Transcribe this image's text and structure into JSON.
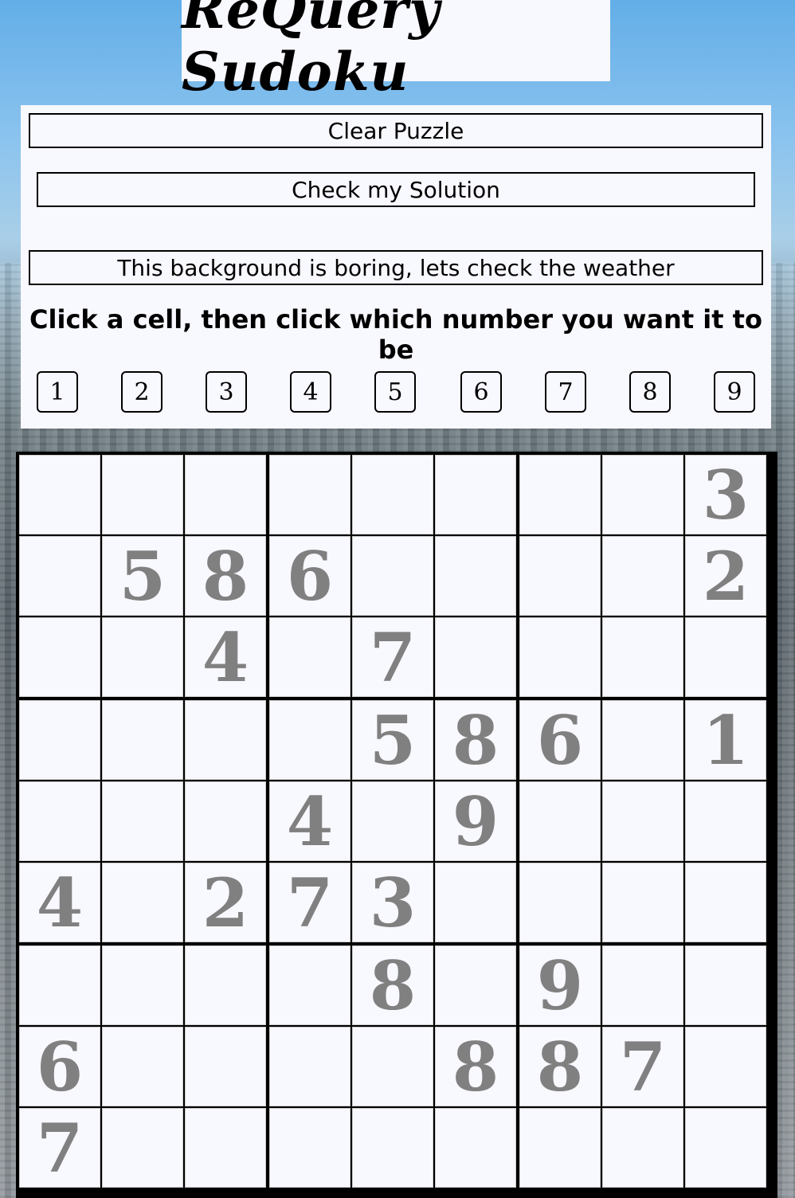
{
  "title": "ReQuery Sudoku",
  "buttons": {
    "clear": "Clear Puzzle",
    "check": "Check my Solution",
    "weather": "This background is boring, lets check the weather"
  },
  "instructions": "Click a cell, then click which number you want it to be",
  "number_picker": [
    "1",
    "2",
    "3",
    "4",
    "5",
    "6",
    "7",
    "8",
    "9"
  ],
  "grid": [
    [
      "",
      "",
      "",
      "",
      "",
      "",
      "",
      "",
      "3"
    ],
    [
      "",
      "5",
      "8",
      "6",
      "",
      "",
      "",
      "",
      "2"
    ],
    [
      "",
      "",
      "4",
      "",
      "7",
      "",
      "",
      "",
      ""
    ],
    [
      "",
      "",
      "",
      "",
      "5",
      "8",
      "6",
      "",
      "1"
    ],
    [
      "",
      "",
      "",
      "4",
      "",
      "9",
      "",
      "",
      ""
    ],
    [
      "4",
      "",
      "2",
      "7",
      "3",
      "",
      "",
      "",
      ""
    ],
    [
      "",
      "",
      "",
      "",
      "8",
      "",
      "9",
      "",
      ""
    ],
    [
      "6",
      "",
      "",
      "",
      "",
      "8",
      "8",
      "7",
      ""
    ],
    [
      "7",
      "",
      "",
      "",
      "",
      "",
      "",
      "",
      ""
    ]
  ],
  "colors": {
    "panel_background": "#f8f8ff",
    "given_digit": "#808080",
    "box_border": "#000000",
    "cell_border": "#cccccc"
  }
}
